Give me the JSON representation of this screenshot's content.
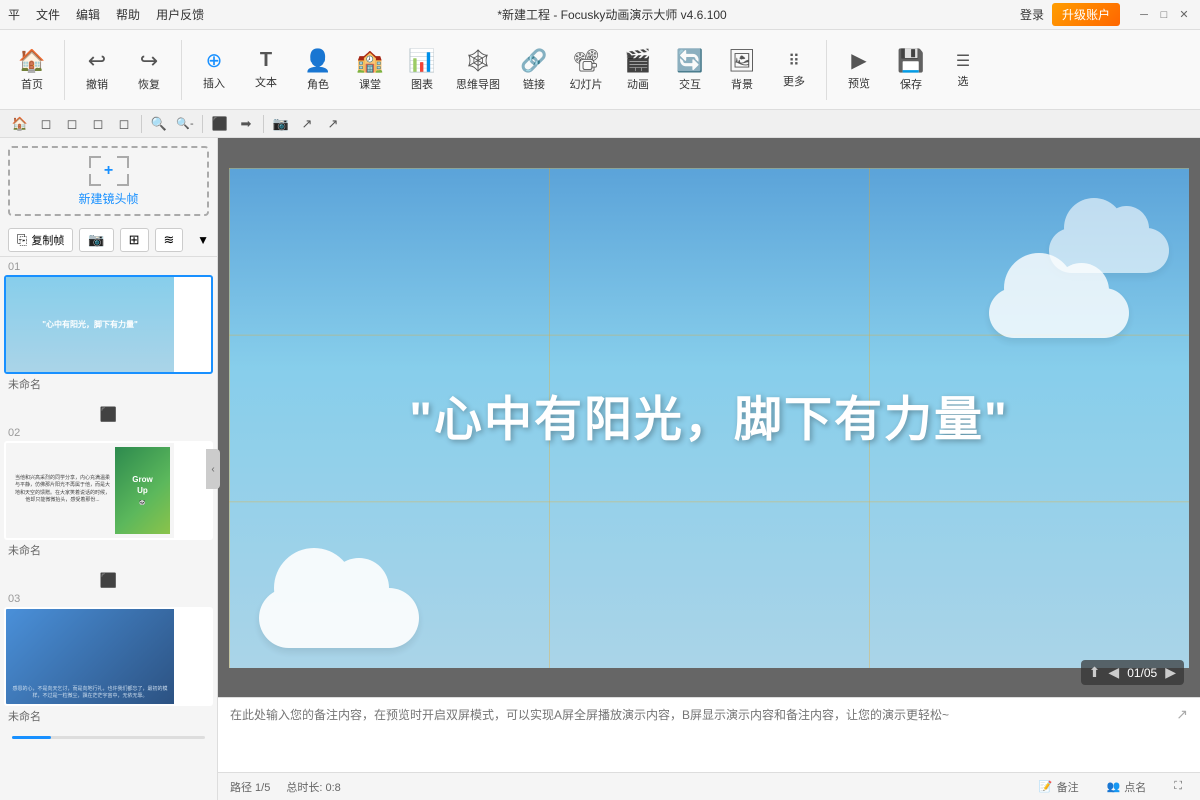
{
  "titlebar": {
    "menu_items": [
      "平",
      "文件",
      "编辑",
      "帮助",
      "用户反馈"
    ],
    "title": "*新建工程 - Focusky动画演示大师 v4.6.100",
    "login": "登录",
    "upgrade": "升级账户",
    "min": "─",
    "max": "□",
    "close": "✕"
  },
  "toolbar": {
    "items": [
      {
        "icon": "🏠",
        "label": "首页"
      },
      {
        "icon": "↩",
        "label": "撤销"
      },
      {
        "icon": "↪",
        "label": "恢复"
      },
      {
        "icon": "➕",
        "label": "插入"
      },
      {
        "icon": "T",
        "label": "文本"
      },
      {
        "icon": "👤",
        "label": "角色"
      },
      {
        "icon": "🏫",
        "label": "课堂"
      },
      {
        "icon": "📊",
        "label": "图表"
      },
      {
        "icon": "🕸",
        "label": "思维导图"
      },
      {
        "icon": "🔗",
        "label": "链接"
      },
      {
        "icon": "📽",
        "label": "幻灯片"
      },
      {
        "icon": "🎬",
        "label": "动画"
      },
      {
        "icon": "🔄",
        "label": "交互"
      },
      {
        "icon": "🖼",
        "label": "背景"
      },
      {
        "icon": "⋯",
        "label": "更多"
      },
      {
        "icon": "▶",
        "label": "预览"
      },
      {
        "icon": "💾",
        "label": "保存"
      },
      {
        "icon": "☰",
        "label": "选"
      }
    ]
  },
  "icon_toolbar": {
    "icons": [
      "🏠",
      "◻",
      "◻",
      "◻",
      "◻",
      "🔍+",
      "🔍-",
      "|",
      "⬛",
      "➡",
      "📷",
      "↗",
      "↗"
    ]
  },
  "left_panel": {
    "new_frame_label": "新建镜头帧",
    "copy_btn": "复制帧",
    "slides": [
      {
        "number": "01",
        "label": "未命名",
        "type": "sky"
      },
      {
        "number": "02",
        "label": "未命名",
        "type": "text_image"
      },
      {
        "number": "03",
        "label": "未命名",
        "type": "photo"
      }
    ]
  },
  "canvas": {
    "main_text": "\"心中有阳光，脚下有力量\""
  },
  "navigation": {
    "page_indicator": "01/05"
  },
  "notes": {
    "placeholder": "在此处输入您的备注内容，在预览时开启双屏模式，可以实现A屏全屏播放演示内容，B屏显示演示内容和备注内容，让您的演示更轻松~"
  },
  "statusbar": {
    "page": "路径 1/5",
    "duration": "总时长: 0:8",
    "notes_label": "备注",
    "points_label": "点名",
    "fullscreen_label": "全屏"
  },
  "colors": {
    "accent": "#1890ff",
    "upgrade_bg": "#ff7700"
  }
}
